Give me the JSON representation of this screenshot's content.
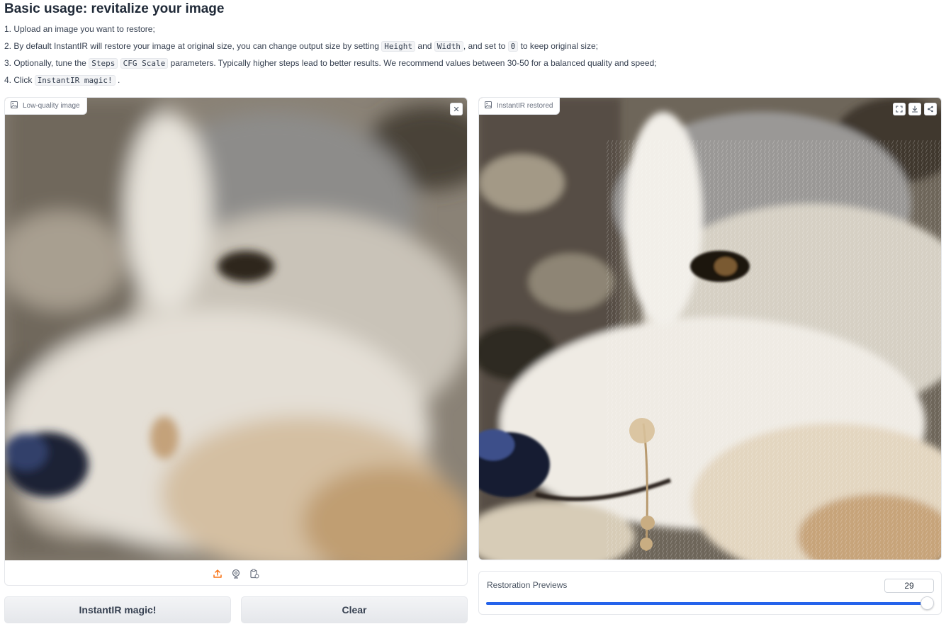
{
  "heading": "Basic usage: revitalize your image",
  "instructions": {
    "line1": "1. Upload an image you want to restore;",
    "line2": {
      "p1": "2. By default InstantIR will restore your image at original size, you can change output size by setting",
      "code1": "Height",
      "p2": "and",
      "code2": "Width",
      "p3": ", and set to",
      "code3": "0",
      "p4": "to keep original size;"
    },
    "line3": {
      "p1": "3. Optionally, tune the",
      "code1": "Steps",
      "code2": "CFG Scale",
      "p2": "parameters. Typically higher steps lead to better results. We recommend values between 30-50 for a balanced quality and speed;"
    },
    "line4": {
      "p1": "4. Click",
      "code1": "InstantIR magic!",
      "p2": "."
    }
  },
  "input_panel": {
    "label": "Low-quality image",
    "close_glyph": "✕",
    "tools": [
      "upload-icon",
      "webcam-icon",
      "clipboard-icon"
    ]
  },
  "output_panel": {
    "label": "InstantIR restored",
    "actions": [
      "fullscreen-icon",
      "download-icon",
      "share-icon"
    ]
  },
  "buttons": {
    "magic": "InstantIR magic!",
    "clear": "Clear"
  },
  "slider": {
    "label": "Restoration Previews",
    "value": "29",
    "fraction": 1.0
  },
  "colors": {
    "accent": "#2563eb",
    "upload_orange": "#f97316"
  }
}
